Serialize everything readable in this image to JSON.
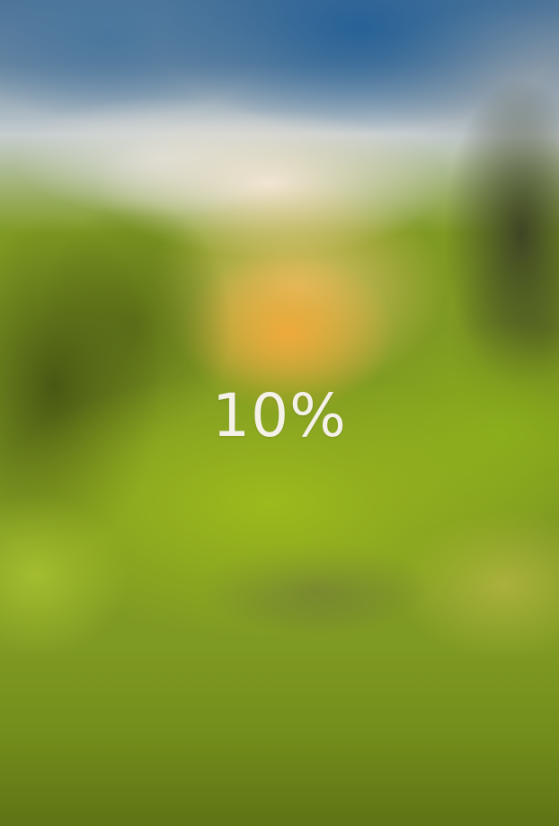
{
  "loading": {
    "progress": 0.1,
    "percent_text": "10%"
  }
}
